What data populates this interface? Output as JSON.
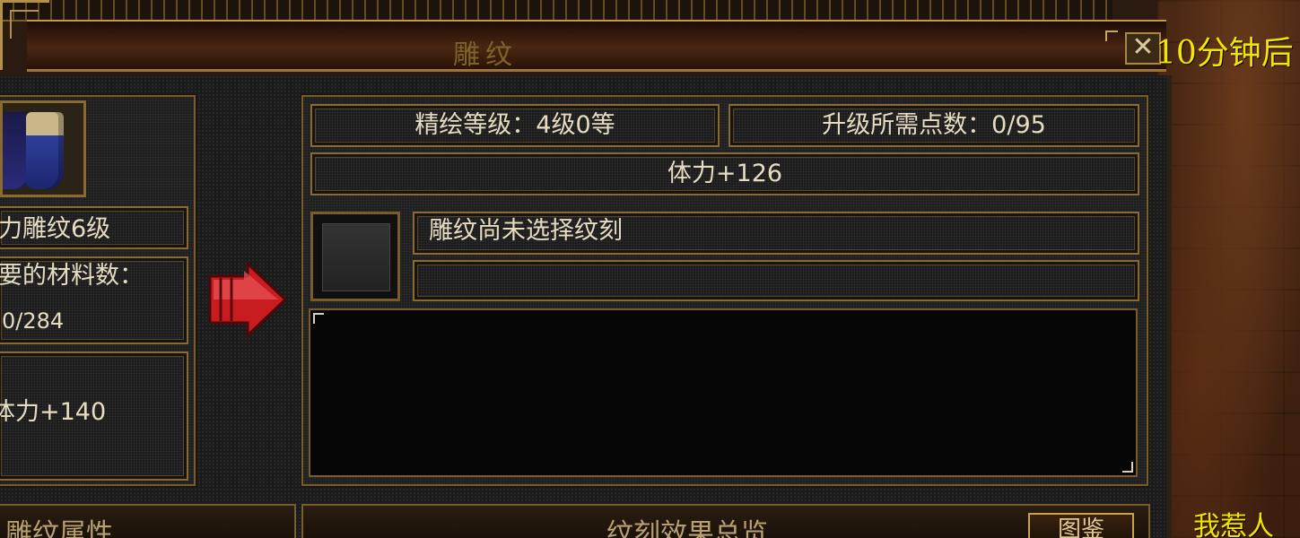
{
  "window": {
    "title": "雕纹",
    "close_label": "✕"
  },
  "notice_text": "10分钟后",
  "corner_text": "我惹人",
  "left": {
    "engrave_level": "力雕纹6级",
    "material_label": "要的材料数：",
    "material_value": "0/284",
    "attr_value": "体力+140"
  },
  "right": {
    "refine_level": "精绘等级：4级0等",
    "upgrade_points": "升级所需点数：0/95",
    "current_attr": "体力+126",
    "engrave_status": "雕纹尚未选择纹刻",
    "engrave_extra": ""
  },
  "tabs": {
    "attr_tab": "雕纹属性",
    "effect_tab": "纹刻效果总览",
    "illustrate_btn": "图鉴"
  },
  "colors": {
    "accent_gold": "#f5e400",
    "frame": "#8a6a32",
    "text": "#e6dcc0"
  }
}
